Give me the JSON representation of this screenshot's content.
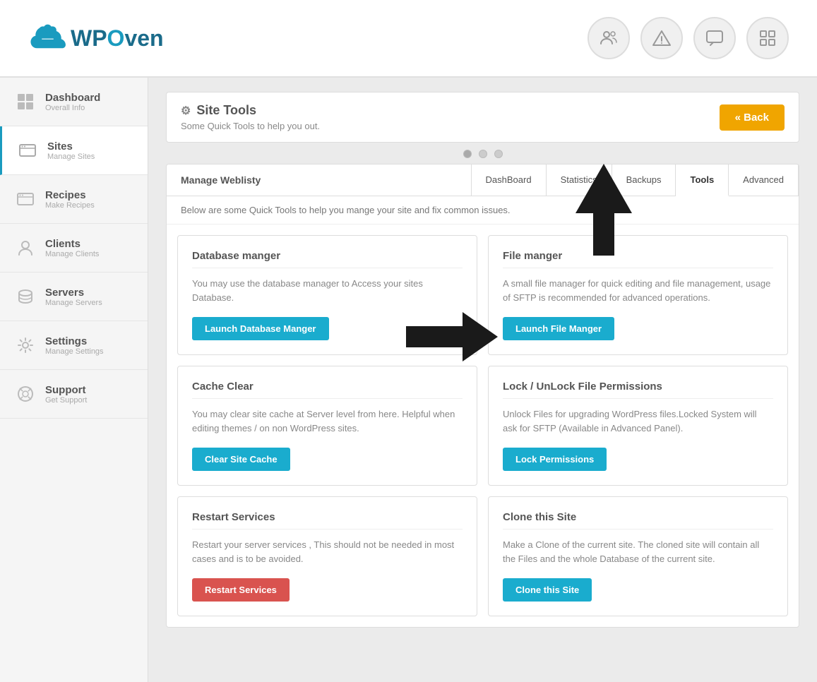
{
  "logo": {
    "text": "WPOven"
  },
  "header": {
    "icons": [
      {
        "name": "users-icon",
        "symbol": "👤"
      },
      {
        "name": "warning-icon",
        "symbol": "⚠"
      },
      {
        "name": "chat-icon",
        "symbol": "💬"
      },
      {
        "name": "grid-icon",
        "symbol": "⊞"
      }
    ]
  },
  "sidebar": {
    "items": [
      {
        "id": "dashboard",
        "title": "Dashboard",
        "sub": "Overall Info",
        "icon": "dashboard"
      },
      {
        "id": "sites",
        "title": "Sites",
        "sub": "Manage Sites",
        "icon": "sites",
        "active": true
      },
      {
        "id": "recipes",
        "title": "Recipes",
        "sub": "Make Recipes",
        "icon": "recipes"
      },
      {
        "id": "clients",
        "title": "Clients",
        "sub": "Manage Clients",
        "icon": "clients"
      },
      {
        "id": "servers",
        "title": "Servers",
        "sub": "Manage Servers",
        "icon": "servers"
      },
      {
        "id": "settings",
        "title": "Settings",
        "sub": "Manage Settings",
        "icon": "settings"
      },
      {
        "id": "support",
        "title": "Support",
        "sub": "Get Support",
        "icon": "support"
      }
    ]
  },
  "site_tools": {
    "title": "Site Tools",
    "subtitle": "Some Quick Tools to help you out.",
    "back_label": "« Back",
    "tabs": {
      "manage_label": "Manage Weblisty",
      "items": [
        {
          "id": "dashboard",
          "label": "DashBoard"
        },
        {
          "id": "statistics",
          "label": "Statistics"
        },
        {
          "id": "backups",
          "label": "Backups"
        },
        {
          "id": "tools",
          "label": "Tools",
          "active": true
        },
        {
          "id": "advanced",
          "label": "Advanced"
        }
      ]
    },
    "tab_desc": "Below are some Quick Tools to help you mange your site and fix common issues.",
    "cards": [
      {
        "id": "database-manager",
        "title": "Database manger",
        "desc": "You may use the database manager to Access your sites Database.",
        "btn_label": "Launch Database Manger",
        "btn_type": "teal"
      },
      {
        "id": "file-manager",
        "title": "File manger",
        "desc": "A small file manager for quick editing and file management, usage of SFTP is recommended for advanced operations.",
        "btn_label": "Launch File Manger",
        "btn_type": "teal"
      },
      {
        "id": "cache-clear",
        "title": "Cache Clear",
        "desc": "You may clear site cache at Server level from here. Helpful when editing themes / on non WordPress sites.",
        "btn_label": "Clear Site Cache",
        "btn_type": "teal"
      },
      {
        "id": "lock-permissions",
        "title": "Lock / UnLock File Permissions",
        "desc": "Unlock Files for upgrading WordPress files.Locked System will ask for SFTP (Available in Advanced Panel).",
        "btn_label": "Lock Permissions",
        "btn_type": "teal"
      },
      {
        "id": "restart-services",
        "title": "Restart Services",
        "desc": "Restart your server services , This should not be needed in most cases and is to be avoided.",
        "btn_label": "Restart Services",
        "btn_type": "red"
      },
      {
        "id": "clone-site",
        "title": "Clone this Site",
        "desc": "Make a Clone of the current site. The cloned site will contain all the Files and the whole Database of the current site.",
        "btn_label": "Clone this Site",
        "btn_type": "teal"
      }
    ]
  }
}
